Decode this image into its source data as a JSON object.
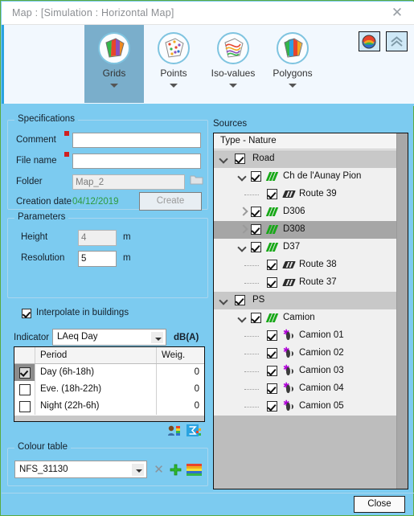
{
  "window": {
    "title": "Map :  [Simulation : Horizontal Map]",
    "close_icon": "close-icon",
    "close_label": "Close"
  },
  "ribbon": {
    "items": [
      {
        "label": "Grids",
        "icon": "grids-icon",
        "selected": true
      },
      {
        "label": "Points",
        "icon": "points-icon",
        "selected": false
      },
      {
        "label": "Iso-values",
        "icon": "iso-values-icon",
        "selected": false
      },
      {
        "label": "Polygons",
        "icon": "polygons-icon",
        "selected": false
      }
    ],
    "right_buttons": [
      {
        "icon": "palette-icon"
      },
      {
        "icon": "collapse-chevrons-icon"
      }
    ]
  },
  "specifications": {
    "title": "Specifications",
    "comment_label": "Comment",
    "comment_value": "",
    "comment_placeholder": "",
    "filename_label": "File name",
    "filename_value": "",
    "filename_placeholder": "",
    "folder_label": "Folder",
    "folder_value": "Map_2",
    "folder_browse_icon": "folder-icon",
    "creation_date_label": "Creation date",
    "creation_date_value": "04/12/2019",
    "create_button": "Create"
  },
  "parameters": {
    "title": "Parameters",
    "height_label": "Height",
    "height_value": "4",
    "height_unit": "m",
    "resolution_label": "Resolution",
    "resolution_value": "5",
    "resolution_unit": "m",
    "interpolate_label": "Interpolate in buildings",
    "interpolate_checked": true,
    "indicator_label": "Indicator",
    "indicator_value": "LAeq Day",
    "indicator_unit": "dB(A)",
    "periods": {
      "columns": [
        "",
        "Period",
        "Weig."
      ],
      "rows": [
        {
          "checked": true,
          "period": "Day (6h-18h)",
          "weight": "0",
          "selected": true
        },
        {
          "checked": false,
          "period": "Eve. (18h-22h)",
          "weight": "0",
          "selected": false
        },
        {
          "checked": false,
          "period": "Night (22h-6h)",
          "weight": "0",
          "selected": false
        }
      ]
    },
    "tool_icons": [
      {
        "name": "user-levels-icon"
      },
      {
        "name": "sigma-export-icon"
      }
    ]
  },
  "colour_table": {
    "title": "Colour table",
    "value": "NFS_31130",
    "buttons": [
      {
        "name": "delete-colour-table-icon",
        "glyph": "✕"
      },
      {
        "name": "add-colour-table-icon",
        "glyph": "✚"
      },
      {
        "name": "edit-palette-icon",
        "glyph": ""
      }
    ]
  },
  "sources": {
    "title": "Sources",
    "column_header": "Type - Nature",
    "nodes": [
      {
        "label": "Road",
        "depth": 0,
        "checked": true,
        "expander": "down",
        "icon": "",
        "group": true,
        "selected": false
      },
      {
        "label": "Ch de l'Aunay Pion",
        "depth": 1,
        "checked": true,
        "expander": "down",
        "icon": "road-icon",
        "group": false,
        "selected": false
      },
      {
        "label": "Route 39",
        "depth": 2,
        "checked": true,
        "expander": "",
        "icon": "route-icon",
        "group": false,
        "selected": false
      },
      {
        "label": "D306",
        "depth": 1,
        "checked": true,
        "expander": "right",
        "icon": "road-icon",
        "group": false,
        "selected": false
      },
      {
        "label": "D308",
        "depth": 1,
        "checked": true,
        "expander": "right",
        "icon": "road-icon",
        "group": false,
        "selected": true
      },
      {
        "label": "D37",
        "depth": 1,
        "checked": true,
        "expander": "down",
        "icon": "road-icon",
        "group": false,
        "selected": false
      },
      {
        "label": "Route 38",
        "depth": 2,
        "checked": true,
        "expander": "",
        "icon": "route-icon",
        "group": false,
        "selected": false
      },
      {
        "label": "Route 37",
        "depth": 2,
        "checked": true,
        "expander": "",
        "icon": "route-icon",
        "group": false,
        "selected": false
      },
      {
        "label": "PS",
        "depth": 0,
        "checked": true,
        "expander": "down",
        "icon": "",
        "group": true,
        "selected": false
      },
      {
        "label": "Camion",
        "depth": 1,
        "checked": true,
        "expander": "down",
        "icon": "road-icon",
        "group": false,
        "selected": false
      },
      {
        "label": "Camion 01",
        "depth": 2,
        "checked": true,
        "expander": "",
        "icon": "point-source-icon",
        "group": false,
        "selected": false
      },
      {
        "label": "Camion 02",
        "depth": 2,
        "checked": true,
        "expander": "",
        "icon": "point-source-icon",
        "group": false,
        "selected": false
      },
      {
        "label": "Camion 03",
        "depth": 2,
        "checked": true,
        "expander": "",
        "icon": "point-source-icon",
        "group": false,
        "selected": false
      },
      {
        "label": "Camion 04",
        "depth": 2,
        "checked": true,
        "expander": "",
        "icon": "point-source-icon",
        "group": false,
        "selected": false
      },
      {
        "label": "Camion 05",
        "depth": 2,
        "checked": true,
        "expander": "",
        "icon": "point-source-icon",
        "group": false,
        "selected": false
      }
    ]
  },
  "colors": {
    "dialog_bg": "#7ccbf0",
    "ribbon_bg": "#f2f8fe",
    "ribbon_selected": "#7aaecb",
    "accent": "#29a3e0",
    "date_green": "#2e9b3e",
    "required_red": "#cf2020",
    "tree_bg": "#f0f0f0",
    "tree_group": "#c8c8c8",
    "tree_selected": "#a6a6a6",
    "tree_empty": "#bdbdbd"
  }
}
